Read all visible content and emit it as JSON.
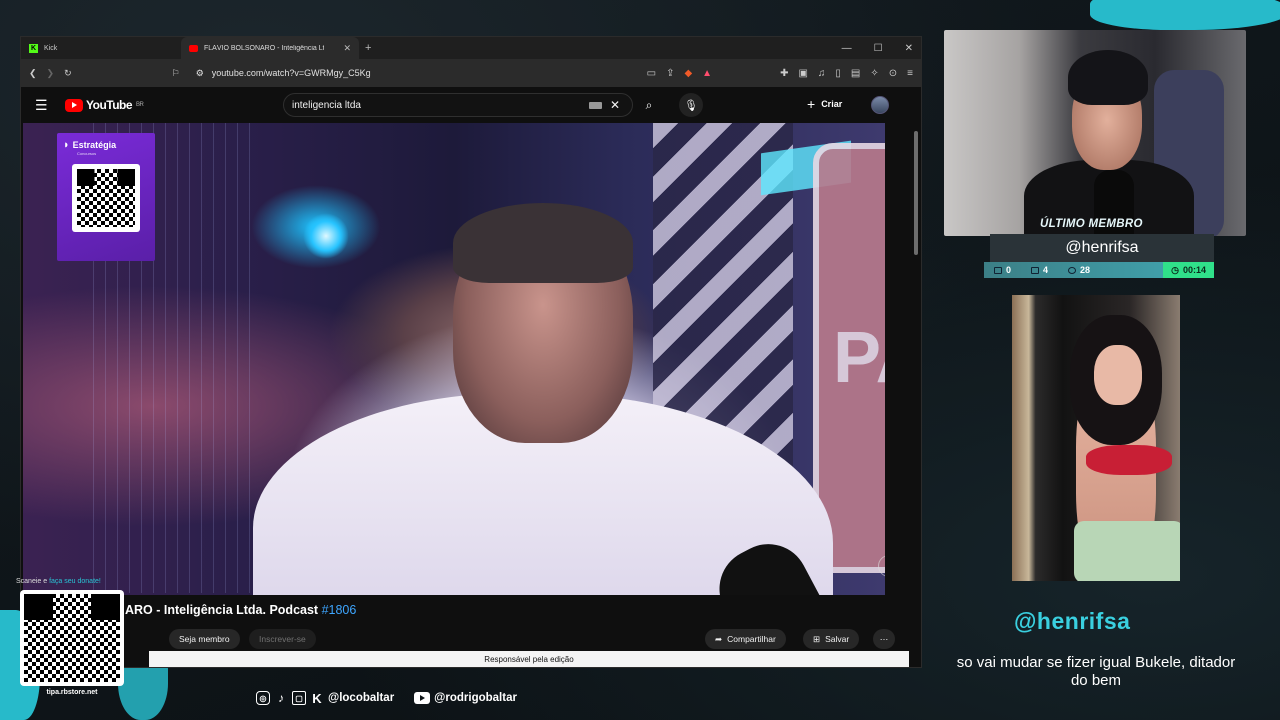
{
  "browser": {
    "tabs": [
      {
        "label": "Kick",
        "favicon": "kick-logo-icon",
        "active": false
      },
      {
        "label": "FLÁVIO BOLSONARO - Inteligência Ltda",
        "favicon": "youtube-favicon-icon",
        "active": true
      }
    ],
    "url": "youtube.com/watch?v=GWRMgy_C5Kg"
  },
  "youtube": {
    "logo_text": "YouTube",
    "region": "BR",
    "search_value": "inteligencia ltda",
    "create_label": "Criar",
    "video_title": "ARO - Inteligência Ltda. Podcast",
    "video_tag": "#1806",
    "join_label": "Seja membro",
    "subscribe_label": "Inscrever-se",
    "share_label": "Compartilhar",
    "save_label": "Salvar",
    "info_bar": "Responsável pela edição",
    "stop_sign_text": "PA",
    "sponsor": {
      "name": "Estratégia",
      "sub": "Concursos"
    }
  },
  "donate": {
    "prefix": "Scaneie e",
    "highlight": "faça seu donate!",
    "url": "tipa.rbstore.net"
  },
  "socials": {
    "kick_handle": "@locobaltar",
    "youtube_handle": "@rodrigobaltar"
  },
  "overlay": {
    "last_member_label": "ÚLTIMO MEMBRO",
    "last_member_name": "@henrifsa",
    "stats": {
      "chat": "0",
      "video": "4",
      "subs": "28",
      "time": "00:14"
    },
    "chat_handle": "@henrifsa",
    "chat_message": "so vai mudar se fizer igual Bukele, ditador do bem"
  },
  "colors": {
    "accent": "#29c3d4",
    "youtube_red": "#ff0000",
    "link_blue": "#3ea6ff",
    "timer_green": "#30e08a"
  }
}
